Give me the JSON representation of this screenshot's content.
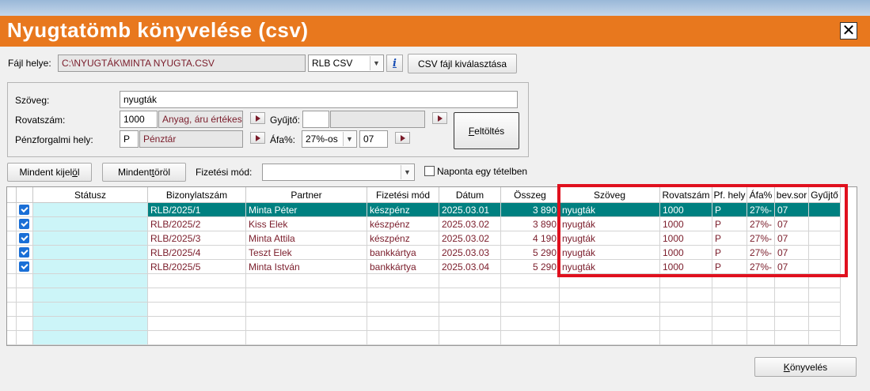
{
  "window": {
    "title": "Nyugtatömb könyvelése (csv)",
    "close_label": "✕"
  },
  "file": {
    "label": "Fájl helye:",
    "path": "C:\\NYUGTÁK\\MINTA NYUGTA.CSV",
    "format": "RLB CSV",
    "info_label": "i",
    "select_button": "CSV fájl kiválasztása"
  },
  "form": {
    "szoveg_label": "Szöveg:",
    "szoveg_value": "nyugták",
    "rovatszam_label": "Rovatszám:",
    "rovatszam_value": "1000",
    "rovatszam_name": "Anyag, áru értékes",
    "gyujto_label": "Gyűjtő:",
    "gyujto_value": "",
    "penzforgalmi_label": "Pénzforgalmi hely:",
    "penzforgalmi_value": "P",
    "penzforgalmi_name": "Pénztár",
    "afa_label": "Áfa%:",
    "afa_value": "27%-os",
    "afa_code": "07",
    "feltoltes_button_pre": "",
    "feltoltes_button_u": "F",
    "feltoltes_button_post": "eltöltés"
  },
  "toolbar": {
    "select_all_pre": "Mindent kijel",
    "select_all_u": "ö",
    "select_all_post": "l",
    "clear_all_pre": "Mindent ",
    "clear_all_u": "t",
    "clear_all_post": "öröl",
    "payment_label": "Fizetési mód:",
    "payment_value": "",
    "daily_label": "Naponta egy tételben"
  },
  "table": {
    "columns": [
      "Státusz",
      "Bizonylatszám",
      "Partner",
      "Fizetési mód",
      "Dátum",
      "Összeg",
      "Szöveg",
      "Rovatszám",
      "Pf. hely",
      "Áfa%",
      "bev.sor",
      "Gyűjtő"
    ],
    "rows": [
      {
        "bizonylat": "RLB/2025/1",
        "partner": "Minta Péter",
        "fizetes": "készpénz",
        "datum": "2025.03.01",
        "osszeg": "3 890",
        "szoveg": "nyugták",
        "rovatszam": "1000",
        "pf": "P",
        "afa": "27%-",
        "bevsor": "07",
        "gyujto": ""
      },
      {
        "bizonylat": "RLB/2025/2",
        "partner": "Kiss Elek",
        "fizetes": "készpénz",
        "datum": "2025.03.02",
        "osszeg": "3 890",
        "szoveg": "nyugták",
        "rovatszam": "1000",
        "pf": "P",
        "afa": "27%-",
        "bevsor": "07",
        "gyujto": ""
      },
      {
        "bizonylat": "RLB/2025/3",
        "partner": "Minta Attila",
        "fizetes": "készpénz",
        "datum": "2025.03.02",
        "osszeg": "4 190",
        "szoveg": "nyugták",
        "rovatszam": "1000",
        "pf": "P",
        "afa": "27%-",
        "bevsor": "07",
        "gyujto": ""
      },
      {
        "bizonylat": "RLB/2025/4",
        "partner": "Teszt Elek",
        "fizetes": "bankkártya",
        "datum": "2025.03.03",
        "osszeg": "5 290",
        "szoveg": "nyugták",
        "rovatszam": "1000",
        "pf": "P",
        "afa": "27%-",
        "bevsor": "07",
        "gyujto": ""
      },
      {
        "bizonylat": "RLB/2025/5",
        "partner": "Minta István",
        "fizetes": "bankkártya",
        "datum": "2025.03.04",
        "osszeg": "5 290",
        "szoveg": "nyugták",
        "rovatszam": "1000",
        "pf": "P",
        "afa": "27%-",
        "bevsor": "07",
        "gyujto": ""
      }
    ]
  },
  "footer": {
    "post_pre": "",
    "post_u": "K",
    "post_post": "önyvelés"
  },
  "colors": {
    "title_bar": "#e8781e",
    "selected_row": "#008080",
    "text_accent": "#7a1c2a",
    "status_column": "#ccf5f8",
    "highlight_box": "#e0101e"
  }
}
